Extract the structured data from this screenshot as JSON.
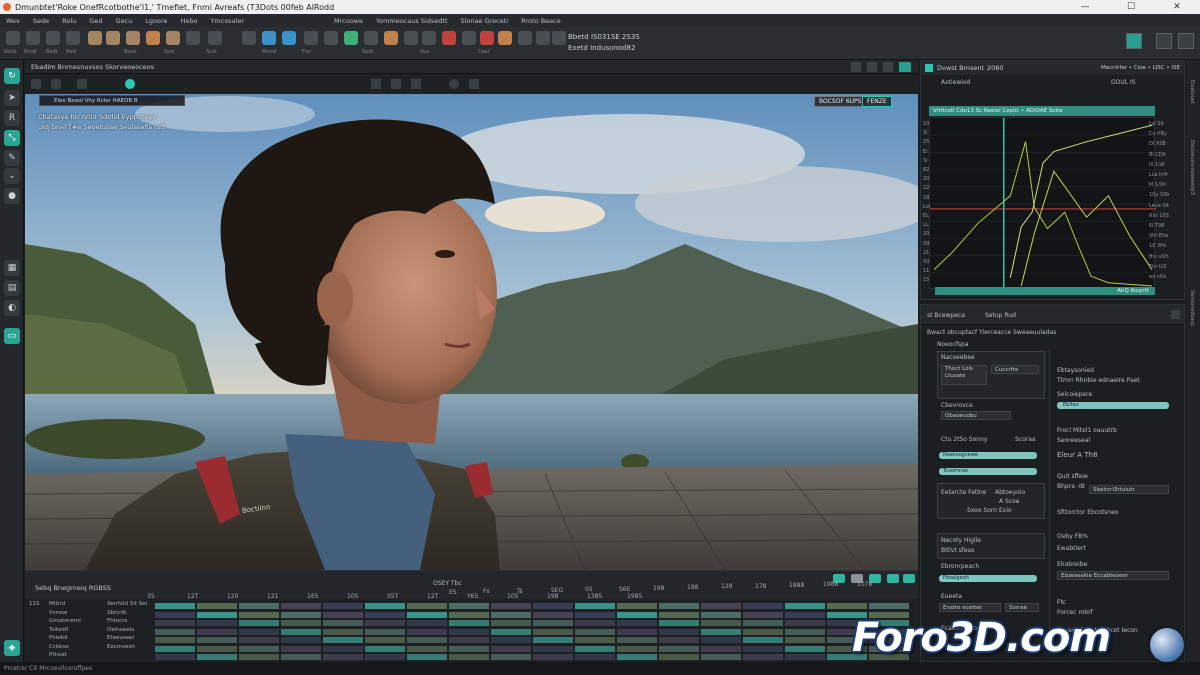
{
  "window": {
    "title": "Dmunbtet'Roke OnefRcotbothe'l1,' Tmefiet, Fnmi Avreafs (T3Dots 00feb AlRodd",
    "controls": [
      "—",
      "☐",
      "✕"
    ]
  },
  "menu": {
    "left": [
      "Wev",
      "Sede",
      "Rolu",
      "Ged",
      "Gecu",
      "Lgoore",
      "Hebo",
      "Ymcosaler"
    ],
    "right": [
      "Mrcoowe",
      "Yommeocaus Sidsedtt",
      "Slonae Greceti",
      "Rroto Beace"
    ]
  },
  "toolbar": {
    "readout_1": "Bbetd  IS031SE 2S3S",
    "readout_2": "Exetd  Indusonod82",
    "tool_labels": [
      "Roob",
      "Boob",
      "Badt",
      "Ned",
      "Bonk",
      "Sool",
      "Sulk",
      "Mosot",
      "Flar",
      "Sodc",
      "Ruu",
      "Ceal"
    ]
  },
  "viewport": {
    "header_title": "Ebadim  Bnrnesnuvsos Skorveoeoceos",
    "overlay_bar": "Eleo Beaol  Vhy   Rcler   HAEOB   B",
    "note_line_1": "Chatesye htr IVtiit Sdlrlid Eyppoteyy",
    "note_line_2": "uldj bnaFT#e 5eoetuilse Seulasefls rstt",
    "tag_1": "BOCSOF 6UPS",
    "tag_2": "FENZE",
    "shirt_label": "Boctiinn"
  },
  "timeline": {
    "title": "Sebq Bnegrneiq RGBSS",
    "center_label": "OSEY  Tbc",
    "ruler": [
      "ES",
      "Fs",
      "Ts",
      "SEG",
      "05",
      "S6E",
      "198",
      "188",
      "128",
      "178",
      "1888",
      "1988",
      "1078"
    ],
    "lower_ruler": [
      "35",
      "12T",
      "120",
      "121",
      "165",
      "105",
      "S5T",
      "12T",
      "Y6S",
      "105",
      "198",
      "1385",
      "1985"
    ],
    "track_names": [
      "Mrbrd",
      "Vsrose",
      "Gmotsnemi",
      "Tsiteotl",
      "Fhiebd",
      "Cckbse",
      "Pthoat"
    ],
    "track_sub": [
      "Xenhitd Sit Sel",
      "Sbrcrib",
      "Fhtocrs",
      "Oelnoeels",
      "Eteeuseei",
      "Eecmsesh"
    ],
    "left_num": "11S"
  },
  "graph_panel": {
    "tab_title": "Dvwst Bmsent",
    "tab_value": "2080",
    "tab_right": "Mecnlrfer  •  Cioe  •  LISC  •  ISE",
    "sub_title": "Axtiewiod",
    "sub_value": "GOUL  IS",
    "strip_label": "Vrtitcstl Cde13 Sc Reeiel Ceplic  • ADIOAE  Sotie",
    "bottom_label": "AhQ  Ibuyrtt",
    "left_ticks": [
      "10",
      "Sl",
      "25",
      "El",
      "Sl",
      "82",
      "20",
      "22",
      "18",
      "Lol",
      "EL",
      "LL",
      "20",
      "09",
      "21",
      "50",
      "11",
      "15"
    ],
    "right_ticks": [
      "Lyl  Slt",
      "Cx  rlBy",
      "Dl  XSB",
      "Bl  CDlt",
      "IlI  1/dl",
      "LLe  hrfr",
      "M  1/00",
      "10y  10b",
      "Leve  Sit",
      "Rhr  10S",
      "El  T98",
      "Sht  Ehe",
      "18  3Hc",
      "Biu  vOh",
      "Ehr  ILS",
      "ed  vOs"
    ]
  },
  "chart_data": {
    "type": "line",
    "series": [
      {
        "values": [
          [
            0.0,
            0.1
          ],
          [
            0.08,
            0.2
          ],
          [
            0.2,
            0.38
          ],
          [
            0.35,
            0.55
          ],
          [
            0.42,
            0.88
          ],
          [
            0.46,
            0.48
          ],
          [
            0.52,
            0.35
          ],
          [
            0.6,
            0.45
          ],
          [
            0.66,
            0.25
          ],
          [
            0.72,
            0.06
          ],
          [
            0.8,
            0.02
          ],
          [
            1.0,
            0.0
          ]
        ]
      },
      {
        "values": [
          [
            0.35,
            0.05
          ],
          [
            0.4,
            0.36
          ],
          [
            0.45,
            0.45
          ],
          [
            0.5,
            0.75
          ],
          [
            0.55,
            0.82
          ],
          [
            0.7,
            0.88
          ],
          [
            0.85,
            0.93
          ],
          [
            1.0,
            0.98
          ]
        ]
      },
      {
        "values": [
          [
            0.4,
            0.0
          ],
          [
            0.46,
            0.32
          ],
          [
            0.55,
            0.7
          ],
          [
            0.7,
            0.42
          ],
          [
            0.8,
            0.55
          ],
          [
            0.9,
            0.3
          ],
          [
            1.0,
            0.1
          ]
        ]
      }
    ],
    "xlim": [
      0,
      1
    ],
    "ylim": [
      0,
      1
    ],
    "reference_line_y": 0.47,
    "playhead_x": 0.32,
    "colors": [
      "#b9c94a",
      "#d6de7a",
      "#c7d55c"
    ],
    "reference_color": "#c23b3b",
    "playhead_color": "#2ec7b1"
  },
  "props_panel": {
    "tabs": [
      "st  Bcewpeca",
      "Setup  Rud"
    ],
    "subtitle": "Bwact obcuptacf Yierceacce Sweaeuuladas",
    "section": "Noeocfspa",
    "left": {
      "g1_title": "Nacoeebee",
      "g1_field_a": "Thoct Lols\nLtusate",
      "g1_field_b": "Cuccrtte",
      "g2_title": "Cbevrovce",
      "g2_field": "Obaoeuobu",
      "row_a_l": "Ctu 2tSo Sonny",
      "row_a_r": "Scoraa",
      "slider_a": "Nseovegvewe",
      "slider_b": "Tcuomnse",
      "g3_l": "Eetarcte Fetlne",
      "g3_r1": "Abtoeyoio",
      "g3_r2": "A  Scoe",
      "g3_r3": "Sxoo    Sorn Exio",
      "g4_title": "Necoty Higlle",
      "g4_sub": "Bltlvt sfeas",
      "g5_title": "Ebronrpeach",
      "g5_field": "Fitoalgeoh",
      "g6_title": "Eueeta",
      "g6_field_l": "Enstte ecetter",
      "g6_field_r": "Sorrae",
      "g7_title": "Ecaosoeuyoo"
    },
    "right": {
      "r1": "Ebtaysonied",
      "r2": "Ttmrr Rhnbie  ednaelre Paet",
      "r3": "Selcoiepere",
      "r3_field": "Eblteo",
      "r4": "Frocl Mitel1 oauutrb",
      "r4_sub": "Seoreeseal",
      "r5": "Eleur A Th8",
      "r6": "Quit  sffeie",
      "r6_sub": "Bhpra -IB",
      "r6_field": "Sbelrcrl3rtuiutr",
      "r7": "Sfttorctor Ebcotsneo",
      "r8": "Oeby  FB%",
      "r8_sub": "Ewabtlert",
      "r9": "Ehobreibe",
      "r9_field": "Ebzeseekle Eccabteoeer",
      "r10": "Ftc",
      "r10_sub": "Forcec mbrf",
      "r11": "Avuaer Eaeet  Rchcet Iecon"
    }
  },
  "scrollbar": {
    "text_1": "Eloatouet",
    "text_2": "Eecloecenrnoseeedy3",
    "text_3": "Sensoneduarp"
  },
  "statusbar": {
    "text": "Prcetrsr  Cit Mrcoevllcoroffpes"
  },
  "watermark": {
    "text": "Foro3D.com"
  }
}
